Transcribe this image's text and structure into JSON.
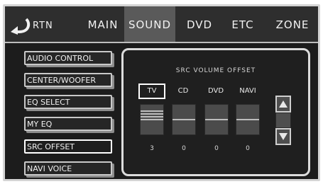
{
  "topbar": {
    "return_label": "RTN",
    "tabs": [
      "MAIN",
      "SOUND",
      "DVD",
      "ETC",
      "ZONE"
    ],
    "active_tab": "SOUND"
  },
  "menu": {
    "items": [
      "AUDIO CONTROL",
      "CENTER/WOOFER",
      "EQ SELECT",
      "MY EQ",
      "SRC OFFSET",
      "NAVI VOICE"
    ],
    "selected": "SRC OFFSET"
  },
  "panel": {
    "title": "SRC VOLUME OFFSET",
    "sources": [
      {
        "label": "TV",
        "value": "3",
        "selected": true
      },
      {
        "label": "CD",
        "value": "0",
        "selected": false
      },
      {
        "label": "DVD",
        "value": "0",
        "selected": false
      },
      {
        "label": "NAVI",
        "value": "0",
        "selected": false
      }
    ]
  },
  "icons": {
    "return": "return-arrow-icon",
    "up": "triangle-up-icon",
    "down": "triangle-down-icon"
  },
  "colors": {
    "background": "#1c1c1c",
    "active_tab": "#5a5a5a",
    "border": "#d4d4d4"
  }
}
